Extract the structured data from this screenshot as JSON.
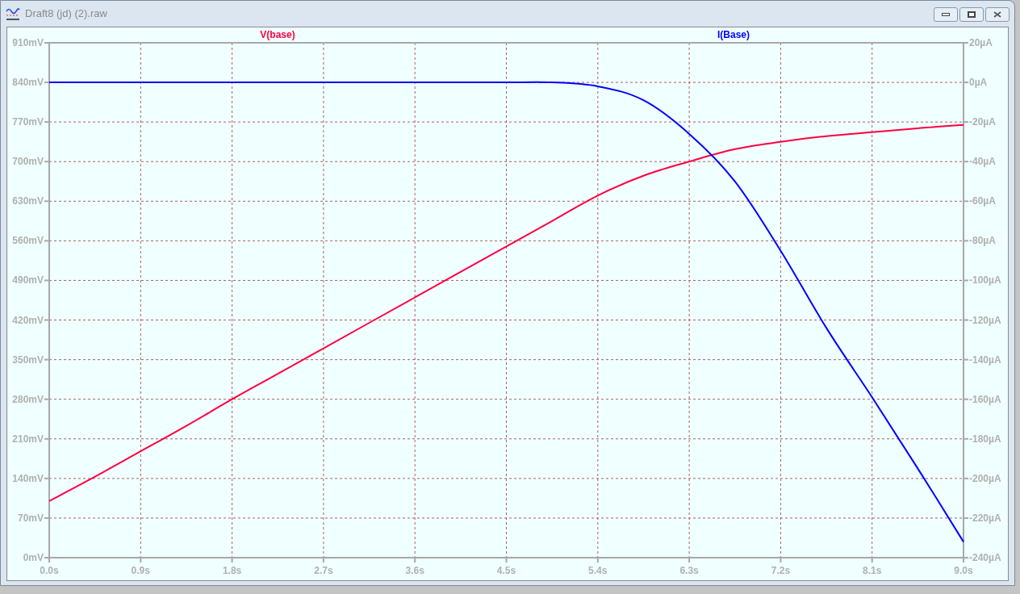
{
  "window": {
    "title": "Draft8 (jd) (2).raw"
  },
  "plot": {
    "chart_data": {
      "type": "line",
      "grid": true,
      "x": [
        0,
        0.45,
        0.9,
        1.35,
        1.8,
        2.25,
        2.7,
        3.15,
        3.6,
        4.05,
        4.5,
        4.95,
        5.4,
        5.85,
        6.3,
        6.75,
        7.2,
        7.65,
        8.1,
        8.55,
        9.0
      ],
      "xlim": [
        0,
        9
      ],
      "xticks": [
        {
          "value": 0,
          "label": "0.0s"
        },
        {
          "value": 0.9,
          "label": "0.9s"
        },
        {
          "value": 1.8,
          "label": "1.8s"
        },
        {
          "value": 2.7,
          "label": "2.7s"
        },
        {
          "value": 3.6,
          "label": "3.6s"
        },
        {
          "value": 4.5,
          "label": "4.5s"
        },
        {
          "value": 5.4,
          "label": "5.4s"
        },
        {
          "value": 6.3,
          "label": "6.3s"
        },
        {
          "value": 7.2,
          "label": "7.2s"
        },
        {
          "value": 8.1,
          "label": "8.1s"
        },
        {
          "value": 9.0,
          "label": "9.0s"
        }
      ],
      "ylim": [
        0,
        910
      ],
      "yticks": [
        {
          "value": 910,
          "label": "910mV"
        },
        {
          "value": 840,
          "label": "840mV"
        },
        {
          "value": 770,
          "label": "770mV"
        },
        {
          "value": 700,
          "label": "700mV"
        },
        {
          "value": 630,
          "label": "630mV"
        },
        {
          "value": 560,
          "label": "560mV"
        },
        {
          "value": 490,
          "label": "490mV"
        },
        {
          "value": 420,
          "label": "420mV"
        },
        {
          "value": 350,
          "label": "350mV"
        },
        {
          "value": 280,
          "label": "280mV"
        },
        {
          "value": 210,
          "label": "210mV"
        },
        {
          "value": 140,
          "label": "140mV"
        },
        {
          "value": 70,
          "label": "70mV"
        },
        {
          "value": 0,
          "label": "0mV"
        }
      ],
      "y2lim": [
        -240,
        20
      ],
      "y2ticks": [
        {
          "value": 20,
          "label": "20µA"
        },
        {
          "value": 0,
          "label": "0µA"
        },
        {
          "value": -20,
          "label": "-20µA"
        },
        {
          "value": -40,
          "label": "-40µA"
        },
        {
          "value": -60,
          "label": "-60µA"
        },
        {
          "value": -80,
          "label": "-80µA"
        },
        {
          "value": -100,
          "label": "-100µA"
        },
        {
          "value": -120,
          "label": "-120µA"
        },
        {
          "value": -140,
          "label": "-140µA"
        },
        {
          "value": -160,
          "label": "-160µA"
        },
        {
          "value": -180,
          "label": "-180µA"
        },
        {
          "value": -200,
          "label": "-200µA"
        },
        {
          "value": -220,
          "label": "-220µA"
        },
        {
          "value": -240,
          "label": "-240µA"
        }
      ],
      "series": [
        {
          "name": "V(base)",
          "color": "#ff0040",
          "values": [
            100,
            143,
            188,
            233,
            280,
            325,
            370,
            415,
            460,
            505,
            550,
            595,
            640,
            675,
            700,
            722,
            735,
            745,
            752,
            759,
            765
          ]
        },
        {
          "name": "I(Base)",
          "color": "#0000ff",
          "axis": "y2",
          "values": [
            0,
            0,
            0,
            0,
            0,
            0,
            0,
            0,
            0,
            0,
            0,
            0,
            -2,
            -9,
            -26,
            -50,
            -85,
            -124,
            -159,
            -195,
            -232
          ]
        }
      ]
    }
  }
}
